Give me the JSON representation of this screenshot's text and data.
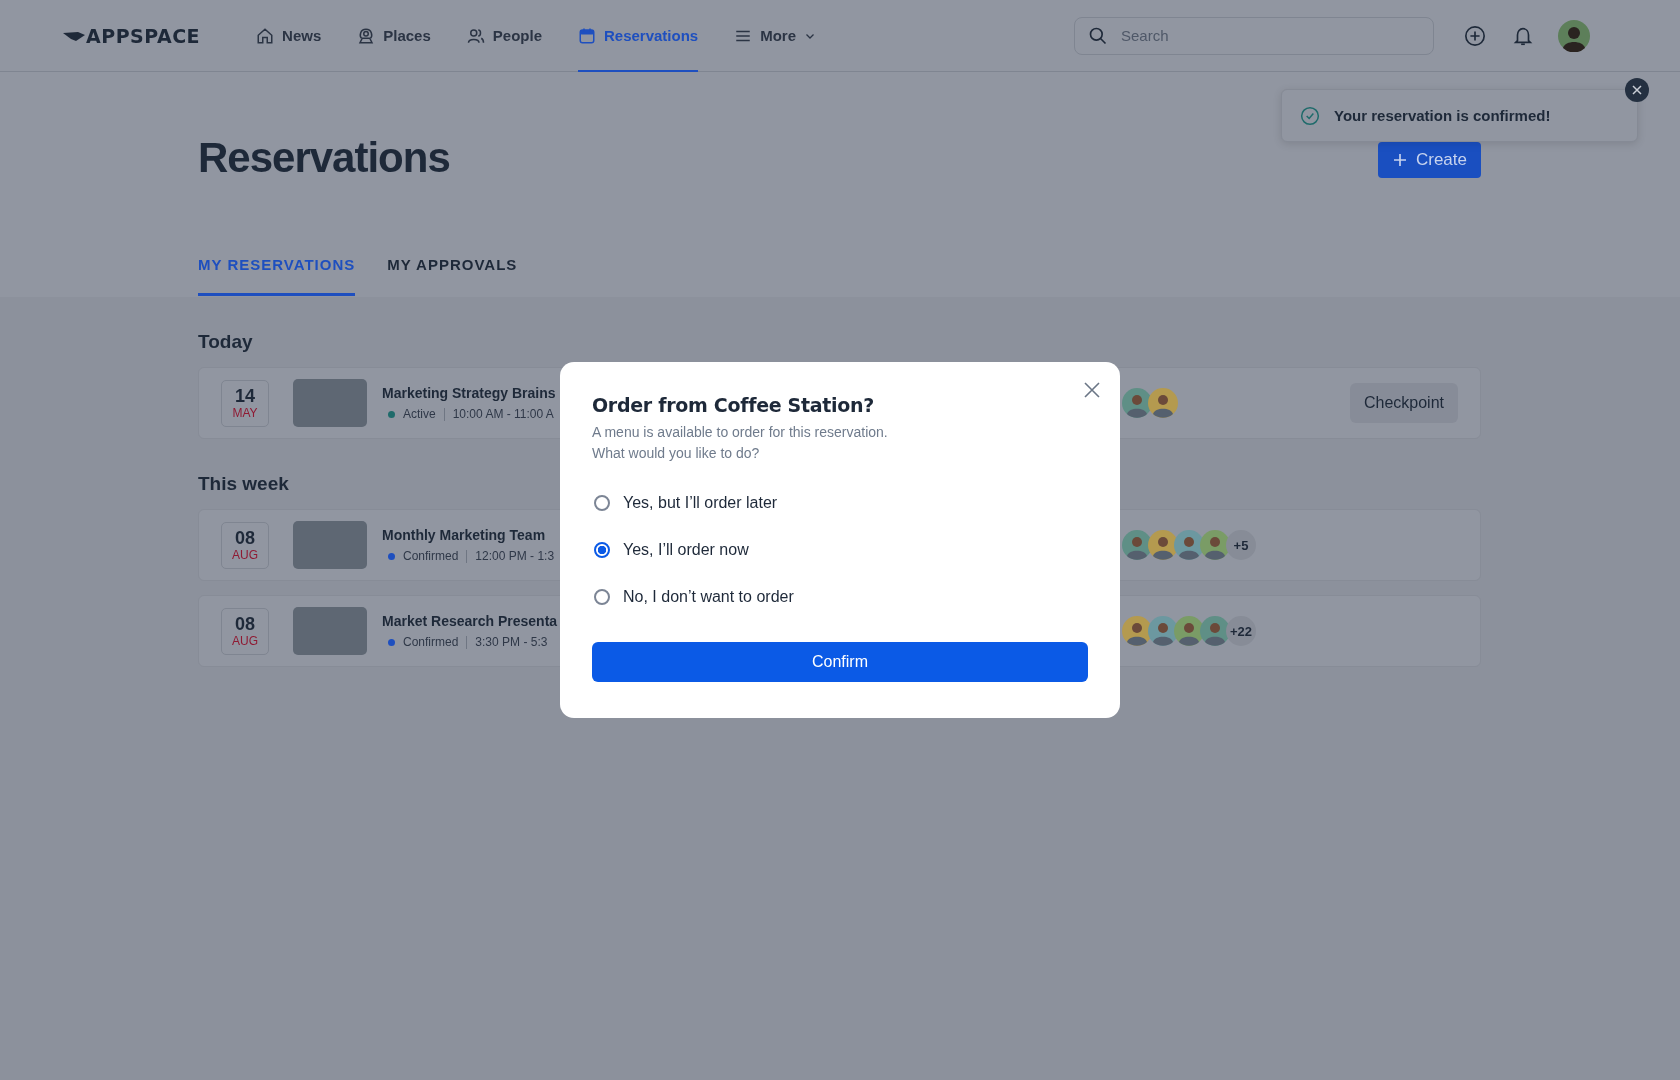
{
  "header": {
    "logo": "APPSPACE",
    "nav": [
      {
        "label": "News",
        "selected": false
      },
      {
        "label": "Places",
        "selected": false
      },
      {
        "label": "People",
        "selected": false
      },
      {
        "label": "Reservations",
        "selected": true
      },
      {
        "label": "More",
        "selected": false,
        "dropdown": true
      }
    ],
    "search": {
      "placeholder": "Search"
    }
  },
  "toast": {
    "message": "Your reservation is confirmed!"
  },
  "page": {
    "title": "Reservations",
    "create_button": "Create",
    "tabs": [
      {
        "label": "MY RESERVATIONS",
        "selected": true
      },
      {
        "label": "MY APPROVALS",
        "selected": false
      }
    ]
  },
  "sections": [
    {
      "heading": "Today",
      "reservations": [
        {
          "day": "14",
          "month": "MAY",
          "title": "Marketing Strategy Brains",
          "status": "Active",
          "color": "#1f6b6b",
          "time": "10:00 AM - 11:00 A",
          "attendees": [
            {
              "kind": "photo"
            },
            {
              "kind": "photo"
            }
          ],
          "action": "Checkpoint"
        }
      ]
    },
    {
      "heading": "This week",
      "reservations": [
        {
          "day": "08",
          "month": "AUG",
          "title": "Monthly Marketing Team",
          "status": "Confirmed",
          "color": "#1e4fbf",
          "time": "12:00 PM - 1:3",
          "attendees": [
            {
              "kind": "photo"
            },
            {
              "kind": "photo"
            },
            {
              "kind": "photo"
            },
            {
              "kind": "photo"
            }
          ],
          "extra": "+5"
        },
        {
          "day": "08",
          "month": "AUG",
          "title": "Market Research Presenta",
          "status": "Confirmed",
          "color": "#1e4fbf",
          "time": "3:30 PM - 5:3",
          "attendees": [
            {
              "kind": "photo"
            },
            {
              "kind": "photo"
            },
            {
              "kind": "photo"
            },
            {
              "kind": "photo"
            }
          ],
          "extra": "+22"
        }
      ]
    }
  ],
  "dialog": {
    "title": "Order from Coffee Station?",
    "description": [
      "A menu is available to order for this reservation.",
      "What would you like to do?"
    ],
    "options": [
      {
        "label": "Yes, but I’ll order later",
        "selected": false
      },
      {
        "label": "Yes, I’ll order now",
        "selected": true
      },
      {
        "label": "No, I don’t want to order",
        "selected": false
      }
    ],
    "confirm_button": "Confirm"
  }
}
